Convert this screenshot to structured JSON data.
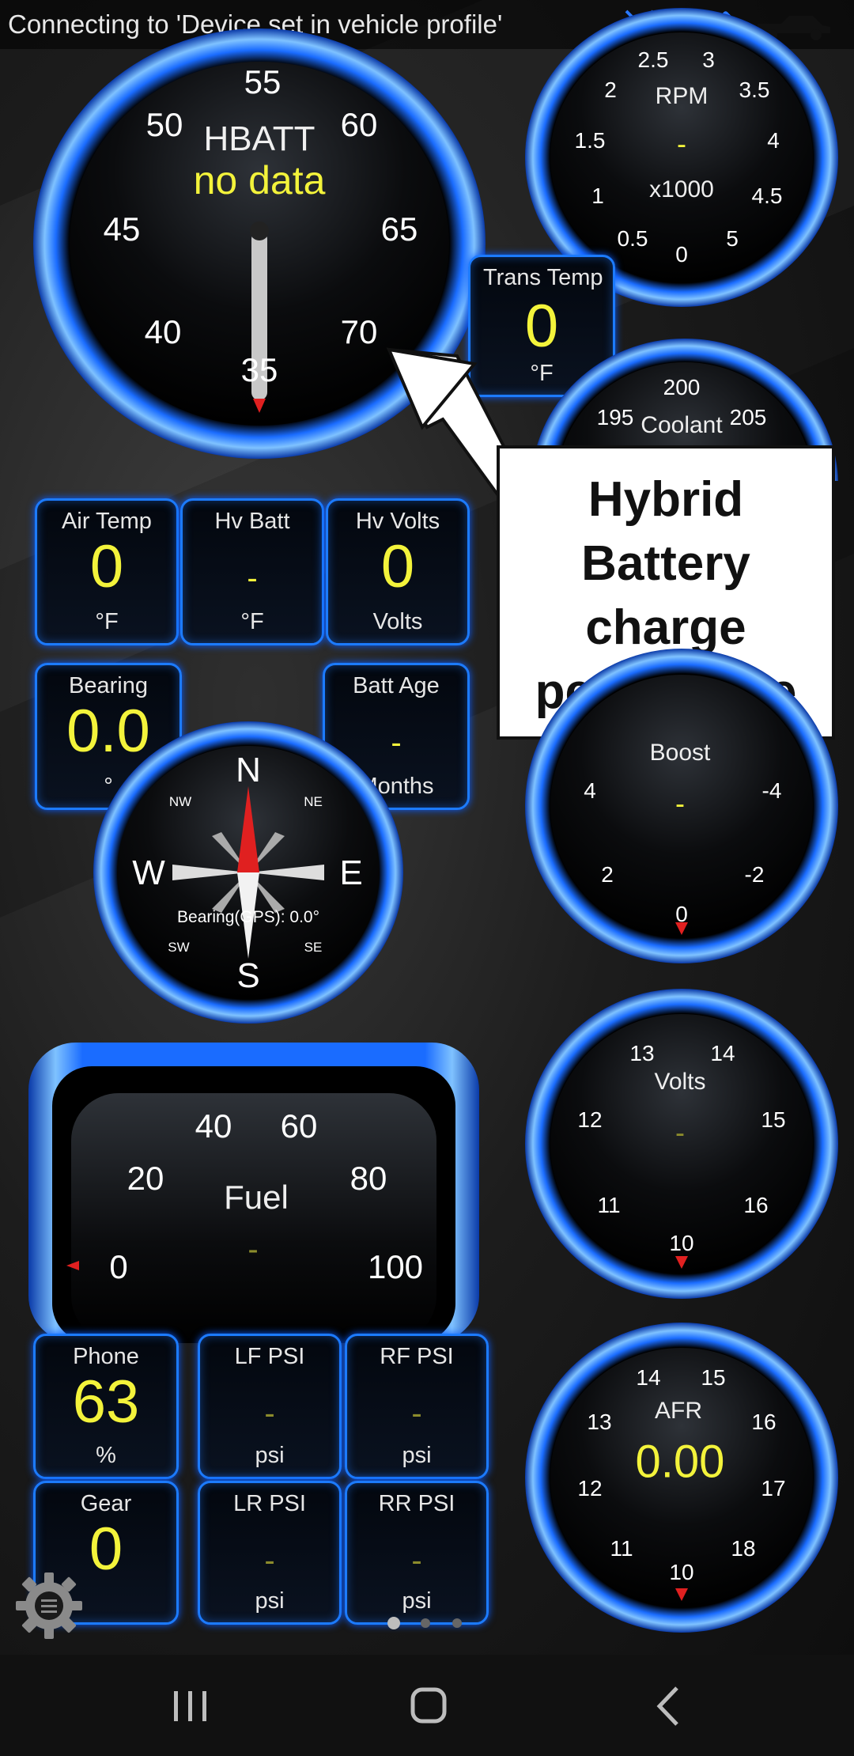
{
  "status": {
    "connecting_text": "Connecting to 'Device set in vehicle profile'"
  },
  "colors": {
    "accent": "#1c7bff",
    "value": "#f3f33b",
    "needle_marker": "#e02020"
  },
  "hbatt": {
    "title": "HBATT",
    "value": "no data",
    "ticks": [
      "35",
      "40",
      "45",
      "50",
      "55",
      "60",
      "65",
      "70"
    ]
  },
  "rpm": {
    "title": "RPM",
    "value": "-",
    "unit": "x1000",
    "ticks": [
      "0",
      "0.5",
      "1",
      "1.5",
      "2",
      "2.5",
      "3",
      "3.5",
      "4",
      "4.5",
      "5"
    ]
  },
  "trans_temp": {
    "title": "Trans Temp",
    "value": "0",
    "unit": "°F"
  },
  "coolant": {
    "title": "Coolant",
    "ticks": [
      "195",
      "200",
      "205"
    ]
  },
  "callout": {
    "line1": "Hybrid",
    "line2": "Battery",
    "line3": "charge",
    "line4": "percentage"
  },
  "air_temp": {
    "title": "Air Temp",
    "value": "0",
    "unit": "°F"
  },
  "hv_batt": {
    "title": "Hv Batt",
    "value": "-",
    "unit": "°F"
  },
  "hv_volts": {
    "title": "Hv Volts",
    "value": "0",
    "unit": "Volts"
  },
  "bearing": {
    "title": "Bearing",
    "value": "0.0",
    "unit": "°"
  },
  "batt_age": {
    "title": "Batt Age",
    "value": "-",
    "unit": "Months"
  },
  "compass": {
    "n": "N",
    "s": "S",
    "e": "E",
    "w": "W",
    "ne": "NE",
    "nw": "NW",
    "se": "SE",
    "sw": "SW",
    "bearing_text": "Bearing(GPS): 0.0°"
  },
  "boost": {
    "title": "Boost",
    "value": "-",
    "ticks": [
      "4",
      "2",
      "0",
      "-2",
      "-4"
    ]
  },
  "volts": {
    "title": "Volts",
    "value": "-",
    "ticks": [
      "10",
      "11",
      "12",
      "13",
      "14",
      "15",
      "16"
    ]
  },
  "fuel": {
    "title": "Fuel",
    "value": "-",
    "ticks": [
      "0",
      "20",
      "40",
      "60",
      "80",
      "100"
    ]
  },
  "phone": {
    "title": "Phone",
    "value": "63",
    "unit": "%"
  },
  "lf_psi": {
    "title": "LF PSI",
    "value": "-",
    "unit": "psi"
  },
  "rf_psi": {
    "title": "RF PSI",
    "value": "-",
    "unit": "psi"
  },
  "gear": {
    "title": "Gear",
    "value": "0"
  },
  "lr_psi": {
    "title": "LR PSI",
    "value": "-",
    "unit": "psi"
  },
  "rr_psi": {
    "title": "RR PSI",
    "value": "-",
    "unit": "psi"
  },
  "afr": {
    "title": "AFR",
    "value": "0.00",
    "ticks": [
      "10",
      "11",
      "12",
      "13",
      "14",
      "15",
      "16",
      "17",
      "18"
    ]
  },
  "icons": {
    "satellite": "satellite-icon",
    "phone": "phone-icon",
    "bluetooth": "bluetooth-adapter-icon",
    "truck": "truck-icon",
    "settings": "gear-menu-icon"
  },
  "page_dots": {
    "count": 3,
    "active": 0
  }
}
